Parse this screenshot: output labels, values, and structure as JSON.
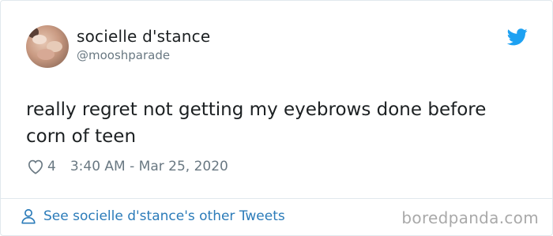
{
  "tweet": {
    "display_name": "socielle d'stance",
    "handle": "@mooshparade",
    "text": "really regret not getting my eyebrows done before corn of teen",
    "likes": "4",
    "timestamp": "3:40 AM - Mar 25, 2020"
  },
  "footer": {
    "link_label": "See socielle d'stance's other Tweets",
    "watermark": "boredpanda.com"
  },
  "colors": {
    "link": "#2b7bb9",
    "muted": "#697882",
    "text": "#1c2022",
    "twitter_blue": "#1da1f2"
  },
  "icons": {
    "brand": "twitter-bird-icon",
    "like": "heart-icon",
    "profile": "person-icon"
  }
}
